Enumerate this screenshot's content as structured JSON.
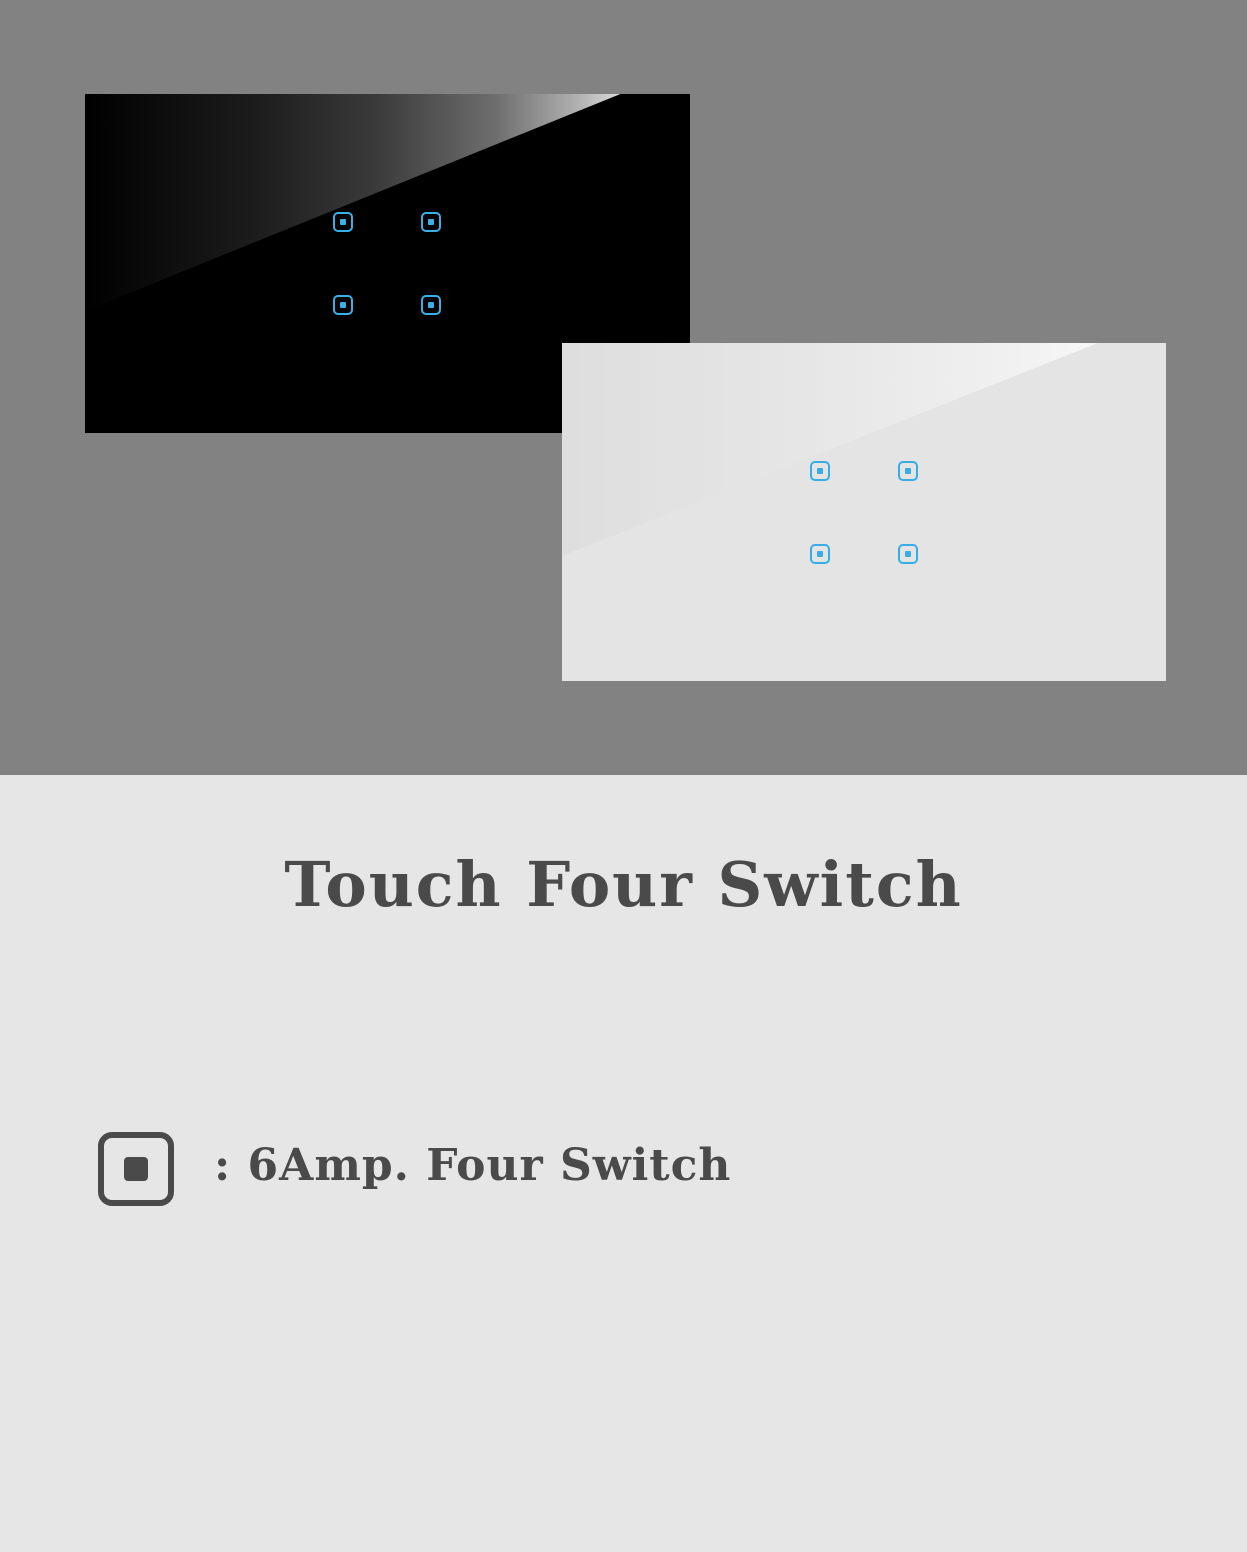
{
  "product": {
    "title": "Touch Four Switch",
    "spec_text": ": 6Amp. Four Switch"
  },
  "panels": [
    {
      "finish": "black",
      "button_count": 4
    },
    {
      "finish": "white",
      "button_count": 4
    }
  ],
  "icons": {
    "touch_button": "touch-button-icon",
    "spec": "switch-button-icon"
  },
  "colors": {
    "backdrop": "#828282",
    "page_background": "#e6e6e6",
    "text": "#4a4a4a",
    "button_accent": "#3ab0e6",
    "black_panel": "#000000",
    "white_panel": "#e4e4e4"
  }
}
